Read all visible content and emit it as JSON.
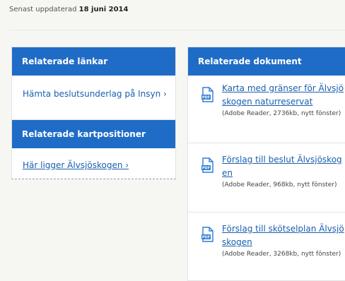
{
  "page": {
    "updated_label": "Senast uppdaterad",
    "updated_date": "18 juni 2014"
  },
  "related_links": {
    "heading": "Relaterade länkar",
    "items": [
      {
        "label": "Hämta beslutsunderlag på Insyn ›"
      }
    ]
  },
  "related_map_positions": {
    "heading": "Relaterade kartpositioner",
    "items": [
      {
        "label": "Här ligger Älvsjöskogen ›"
      }
    ]
  },
  "related_documents": {
    "heading": "Relaterade dokument",
    "items": [
      {
        "title": "Karta med gränser för Älvsjöskogen naturreservat",
        "meta": "(Adobe Reader, 2736kb, nytt fönster)",
        "icon": "pdf-icon"
      },
      {
        "title": "Förslag till beslut Älvsjöskogen",
        "meta": "(Adobe Reader, 968kb, nytt fönster)",
        "icon": "pdf-icon"
      },
      {
        "title": "Förslag till skötselplan Älvsjöskogen",
        "meta": "(Adobe Reader, 3268kb, nytt fönster)",
        "icon": "pdf-icon"
      }
    ]
  },
  "colors": {
    "header_blue": "#1f6cc7",
    "link_blue": "#1a5fae",
    "pdf_icon_blue": "#2d7bd6"
  }
}
